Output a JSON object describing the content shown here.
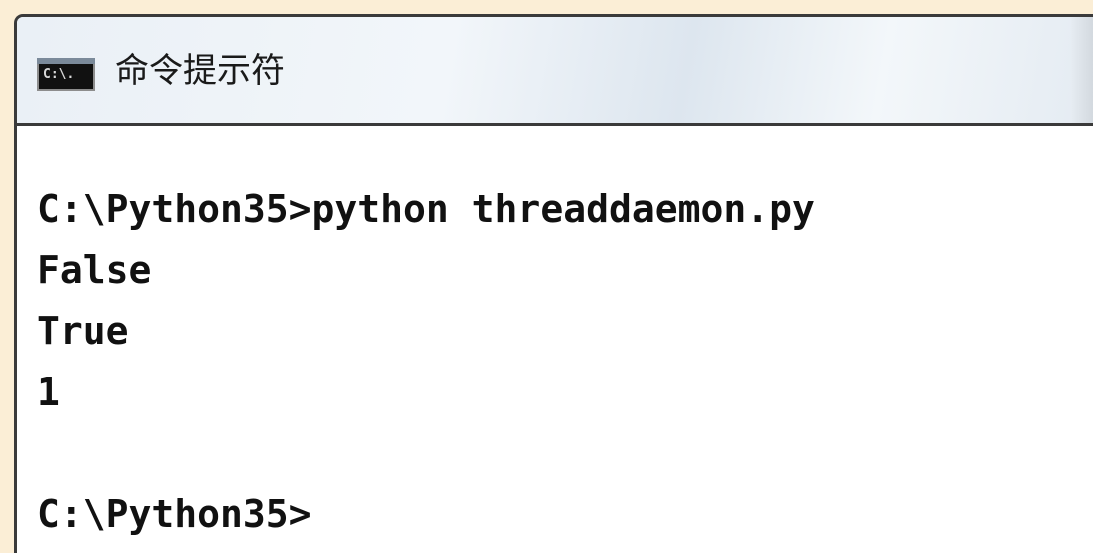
{
  "window": {
    "title": "命令提示符",
    "icon": "cmd-prompt-icon",
    "icon_text": "C:\\."
  },
  "console": {
    "lines": [
      "C:\\Python35>python threaddaemon.py",
      "False",
      "True",
      "1",
      "",
      "C:\\Python35>"
    ]
  }
}
